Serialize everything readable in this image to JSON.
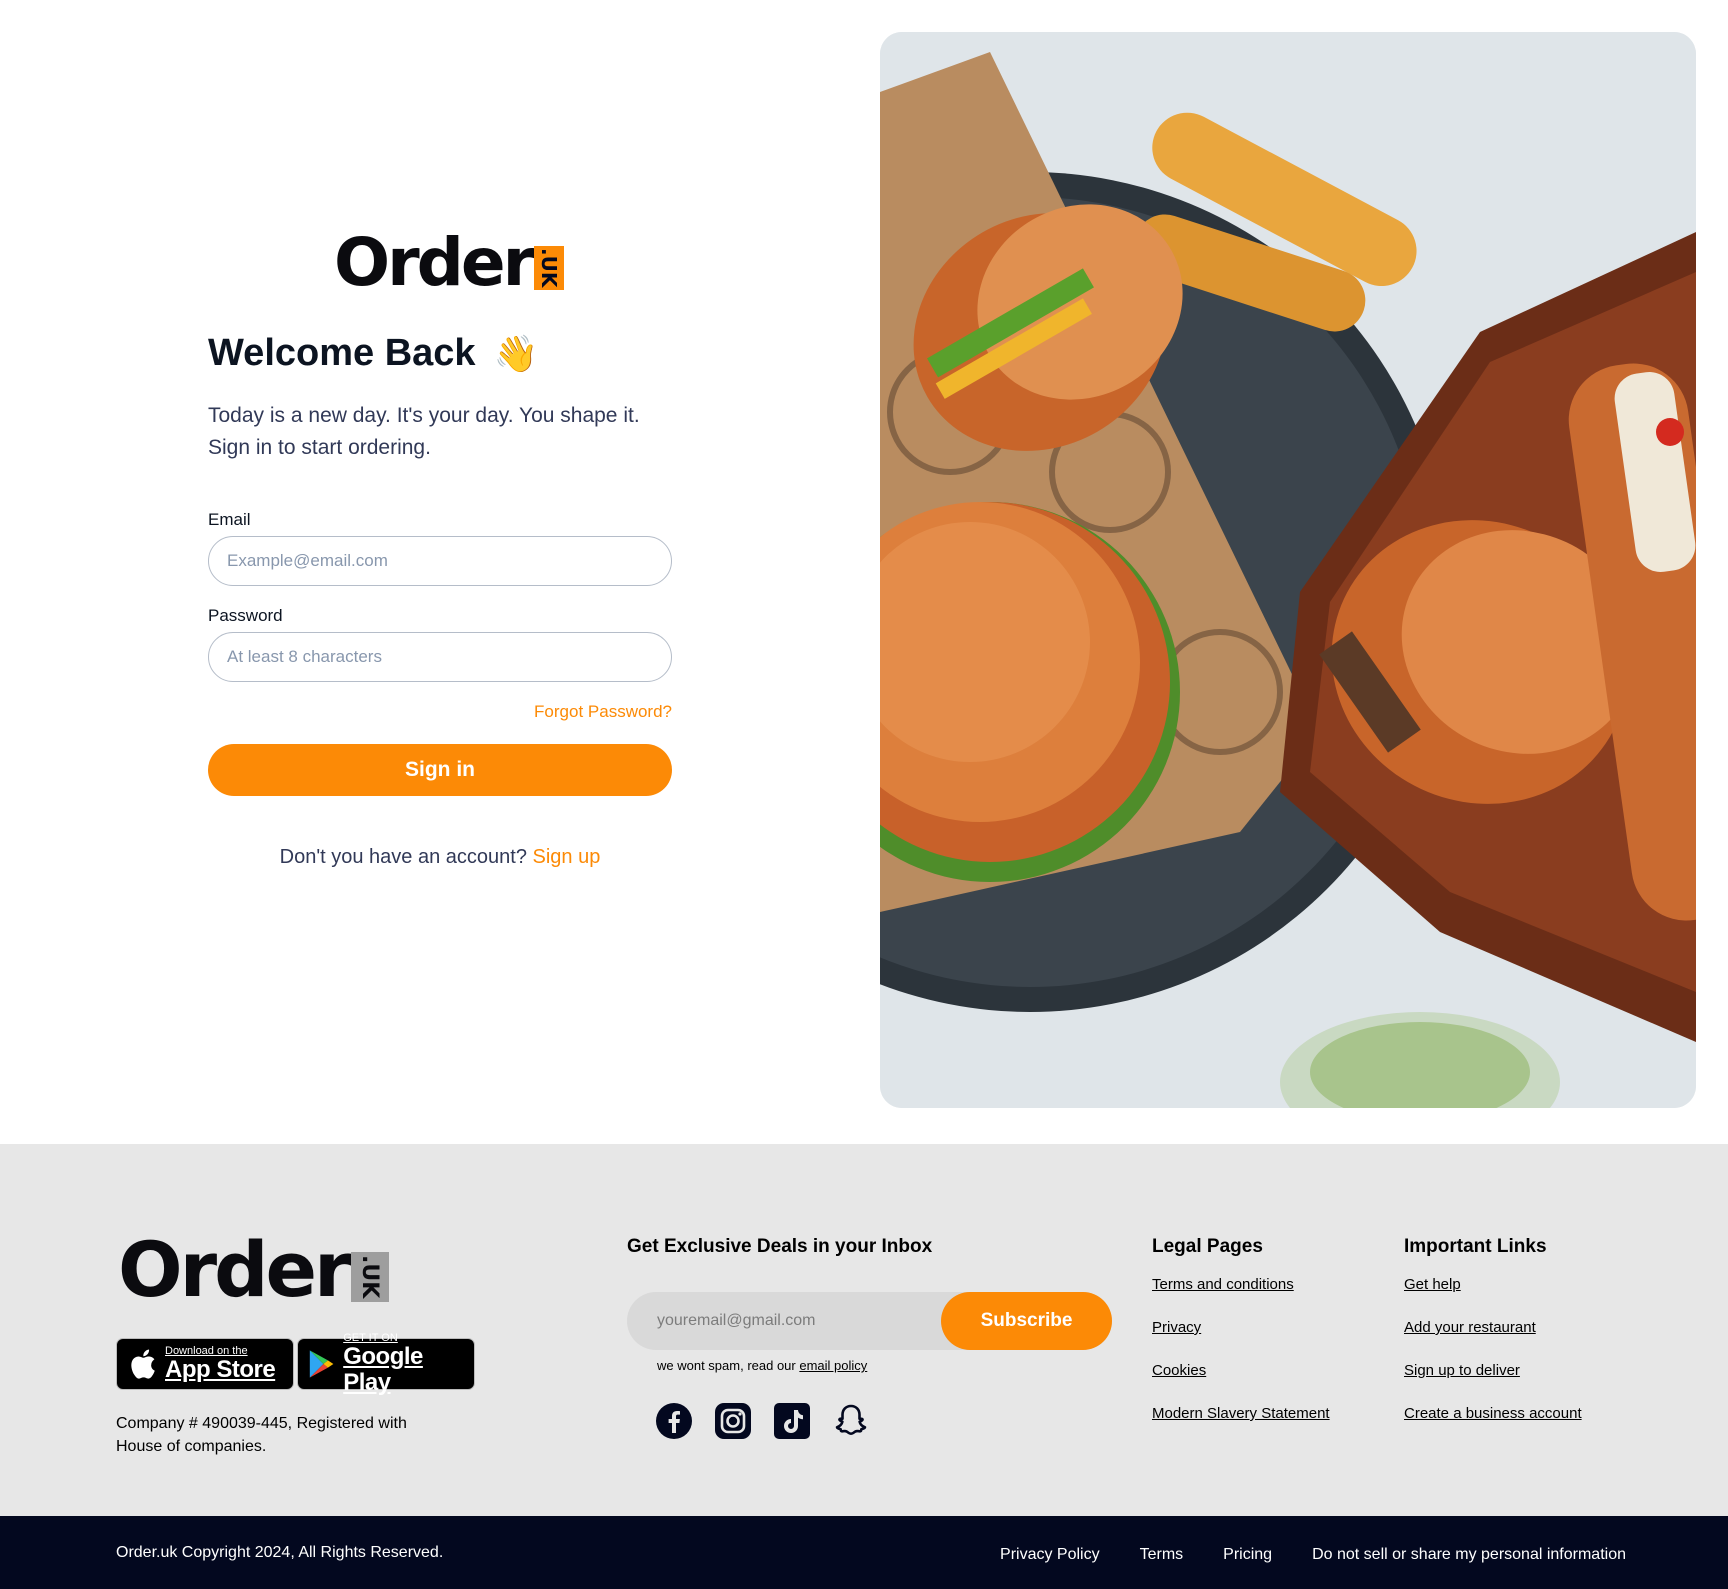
{
  "brand": {
    "logo_word": "Order",
    "logo_badge": ".UK"
  },
  "login": {
    "welcome": "Welcome Back",
    "wave_emoji": "👋",
    "subtitle_line1": "Today is a new day. It's your day. You shape it.",
    "subtitle_line2": "Sign in to start ordering.",
    "email_label": "Email",
    "email_placeholder": "Example@email.com",
    "password_label": "Password",
    "password_placeholder": "At least 8 characters",
    "forgot_password": "Forgot Password?",
    "signin_button": "Sign in",
    "no_account_text": "Don't you have an account?",
    "signup_link": "Sign up"
  },
  "footer": {
    "app_store_small": "Download on the",
    "app_store_big": "App Store",
    "google_play_small": "GET IT ON",
    "google_play_big": "Google Play",
    "company_info": "Company # 490039-445, Registered with House of companies.",
    "deals_title": "Get Exclusive Deals in your Inbox",
    "subscribe_placeholder": "youremail@gmail.com",
    "subscribe_button": "Subscribe",
    "spam_text": "we wont spam, read our",
    "spam_link": "email policy",
    "socials": [
      "facebook-icon",
      "instagram-icon",
      "tiktok-icon",
      "snapchat-icon"
    ],
    "legal_title": "Legal Pages",
    "legal_links": [
      "Terms and conditions",
      "Privacy",
      "Cookies",
      "Modern Slavery Statement"
    ],
    "important_title": "Important Links",
    "important_links": [
      "Get help",
      "Add your restaurant",
      "Sign up to deliver",
      "Create a business account"
    ]
  },
  "bottombar": {
    "copyright": "Order.uk Copyright 2024, All Rights Reserved.",
    "links": [
      "Privacy Policy",
      "Terms",
      "Pricing",
      "Do not sell or share my personal information"
    ]
  },
  "colors": {
    "accent": "#fc8a06",
    "dark_navy": "#03081f",
    "footer_bg": "#e7e7e7",
    "text_primary": "#0c1421",
    "text_secondary": "#313957"
  }
}
